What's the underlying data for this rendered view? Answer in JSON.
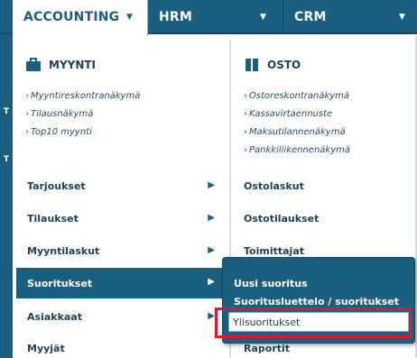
{
  "topnav": {
    "tabs": [
      {
        "label": "ACCOUNTING"
      },
      {
        "label": "HRM"
      },
      {
        "label": "CRM"
      }
    ],
    "side_letter": "T"
  },
  "left_section": {
    "title": "MYYNTI",
    "icon": "briefcase-icon",
    "quick_links": [
      "Myyntireskontranäkymä",
      "Tilausnäkymä",
      "Top10 myynti"
    ],
    "items": [
      "Tarjoukset",
      "Tilaukset",
      "Myyntilaskut",
      "Suoritukset",
      "Asiakkaat",
      "Myyjät"
    ]
  },
  "right_section": {
    "title": "OSTO",
    "icon": "book-icon",
    "quick_links": [
      "Ostoreskontranäkymä",
      "Kassavirtaennuste",
      "Maksutilannenäkymä",
      "Pankkiliikennenäkymä"
    ],
    "items": [
      "Ostolaskut",
      "Ostotilaukset",
      "Toimittajat",
      "Raportit"
    ]
  },
  "submenu": {
    "items": [
      "Uusi suoritus",
      "Suoritusluettelo / suoritukset",
      "Ylisuoritukset"
    ]
  },
  "colors": {
    "accent": "#1b5f80",
    "highlight": "#e0172d"
  }
}
